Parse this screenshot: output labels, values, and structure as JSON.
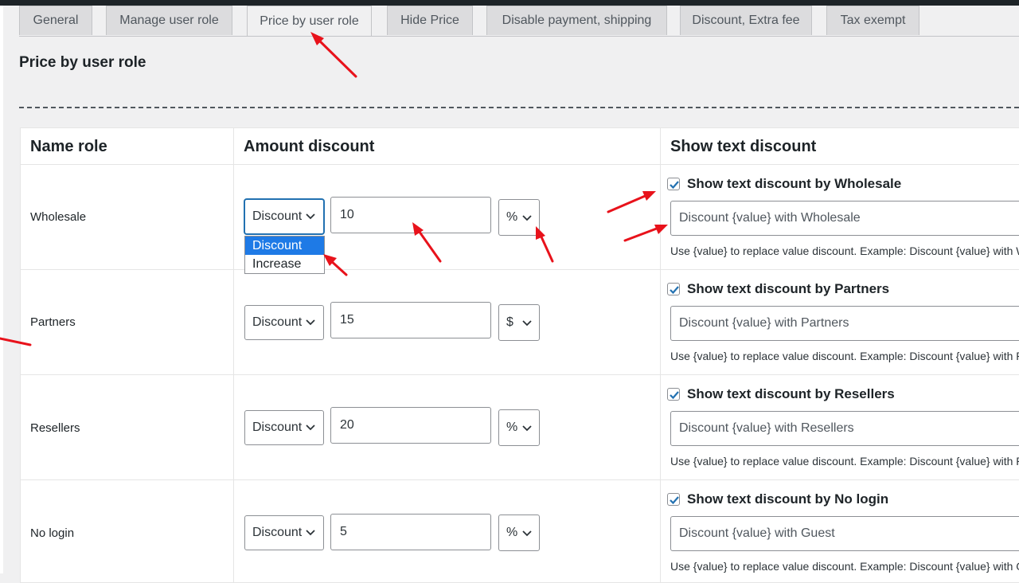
{
  "tabs": [
    {
      "label": "General"
    },
    {
      "label": "Manage user role"
    },
    {
      "label": "Price by user role"
    },
    {
      "label": "Hide Price"
    },
    {
      "label": "Disable payment, shipping"
    },
    {
      "label": "Discount, Extra fee"
    },
    {
      "label": "Tax exempt"
    }
  ],
  "page_title": "Price by user role",
  "table": {
    "headers": {
      "name_role": "Name role",
      "amount_discount": "Amount discount",
      "show_text": "Show text discount"
    },
    "rows": [
      {
        "role": "Wholesale",
        "type": "Discount",
        "amount": "10",
        "unit": "%",
        "checkbox_label": "Show text discount by Wholesale",
        "checked": true,
        "text_value": "Discount {value} with Wholesale",
        "hint": "Use {value} to replace value discount. Example: Discount {value} with Wholesale"
      },
      {
        "role": "Partners",
        "type": "Discount",
        "amount": "15",
        "unit": "$",
        "checkbox_label": "Show text discount by Partners",
        "checked": true,
        "text_value": "Discount {value} with Partners",
        "hint": "Use {value} to replace value discount. Example: Discount {value} with Partners"
      },
      {
        "role": "Resellers",
        "type": "Discount",
        "amount": "20",
        "unit": "%",
        "checkbox_label": "Show text discount by Resellers",
        "checked": true,
        "text_value": "Discount {value} with Resellers",
        "hint": "Use {value} to replace value discount. Example: Discount {value} with Resellers"
      },
      {
        "role": "No login",
        "type": "Discount",
        "amount": "5",
        "unit": "%",
        "checkbox_label": "Show text discount by No login",
        "checked": true,
        "text_value": "Discount {value} with Guest",
        "hint": "Use {value} to replace value discount. Example: Discount {value} with Guest"
      }
    ]
  },
  "dropdown_open": {
    "options": [
      "Discount",
      "Increase"
    ],
    "selected": "Discount"
  },
  "colors": {
    "accent": "#2271b1",
    "annotation_arrow": "#e8121b",
    "dropdown_highlight": "#1e7ae6"
  }
}
